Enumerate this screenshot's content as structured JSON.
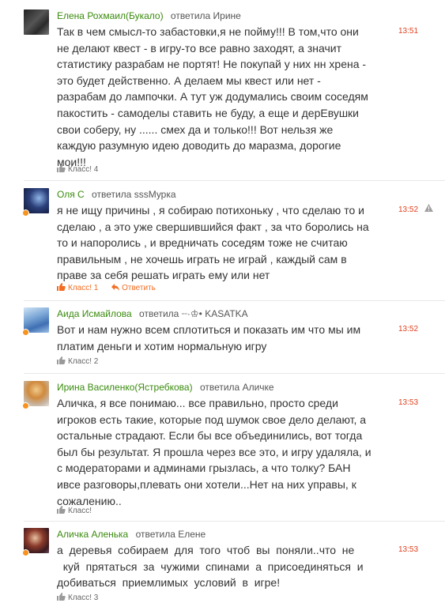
{
  "replied_word": "ответила",
  "klass_word": "Класс!",
  "reply_word": "Ответить",
  "colors": {
    "author": "#3a8b0e",
    "time": "#e0411e",
    "accent": "#f36c21",
    "online": "#f7931e"
  },
  "icons": {
    "like": "thumbs-up-icon",
    "reply": "reply-arrow-icon",
    "warn": "warning-icon"
  },
  "comments": [
    {
      "author": "Елена Рохмаил(Букало)",
      "target": "Ирине",
      "time": "13:51",
      "klass_count": "4",
      "lines": [
        "Так в чем смысл-то забастовки,я не пойму!!! В том,что они",
        "не делают квест - в игру-то все равно заходят, а значит",
        "статистику разрабам не портят! Не покупай у них нн  хрена -",
        "это будет действенно. А делаем мы квест или нет -",
        "разрабам до лампочки.  А тут уж додумались своим соседям",
        "пакостить - самоделы ставить не буду, а еще и дерЕвушки",
        "свои соберу, ну ...... смех да и только!!! Вот нельзя же",
        "каждую разумную идею доводить до маразма, дорогие",
        "мои!!!"
      ]
    },
    {
      "author": "Оля С",
      "target": "sssМурка",
      "time": "13:52",
      "klass_count": "1",
      "lines": [
        "я не ищу причины , я собираю потихоньку , что сделаю то и",
        "сделаю , а это уже свершившийся факт , за что боролись на",
        "то и напоролись , и вредничать соседям тоже не считаю",
        "правильным , не хочешь играть не играй  , каждый сам в",
        "праве за себя решать играть ему или нет"
      ]
    },
    {
      "author": "Аида Исмайлова",
      "target": "┈·♔• KASATKA",
      "time": "13:52",
      "klass_count": "2",
      "lines": [
        "Вот и нам нужно всем сплотиться и показать им что мы им",
        "платим деньги и хотим нормальную игру"
      ]
    },
    {
      "author": "Ирина Василенко(Ястребкова)",
      "target": "Аличке",
      "time": "13:53",
      "klass_count": "",
      "lines": [
        "Аличка,  я все понимаю... все правильно, просто среди",
        "игроков есть такие, которые под шумок свое дело делают, а",
        "остальные страдают. Если бы все объединились, вот тогда",
        "был бы результат. Я прошла через все это, и игру удаляла, и",
        "с модераторами и админами грызлась, а что толку? БАН",
        " ивсе разговоры,плевать они хотели...Нет на них  управы,  к",
        "сожалению.."
      ]
    },
    {
      "author": "Аличка Аленька",
      "target": "Елене",
      "time": "13:53",
      "klass_count": "3",
      "lines": [
        "а  деревья  собираем  для  того  чтоб  вы  поняли..что  не",
        "  куй  прятаться  за  чужими  спинами  а  присоединяться  и",
        "добиваться  приемлимых  условий  в  игре!"
      ]
    }
  ]
}
